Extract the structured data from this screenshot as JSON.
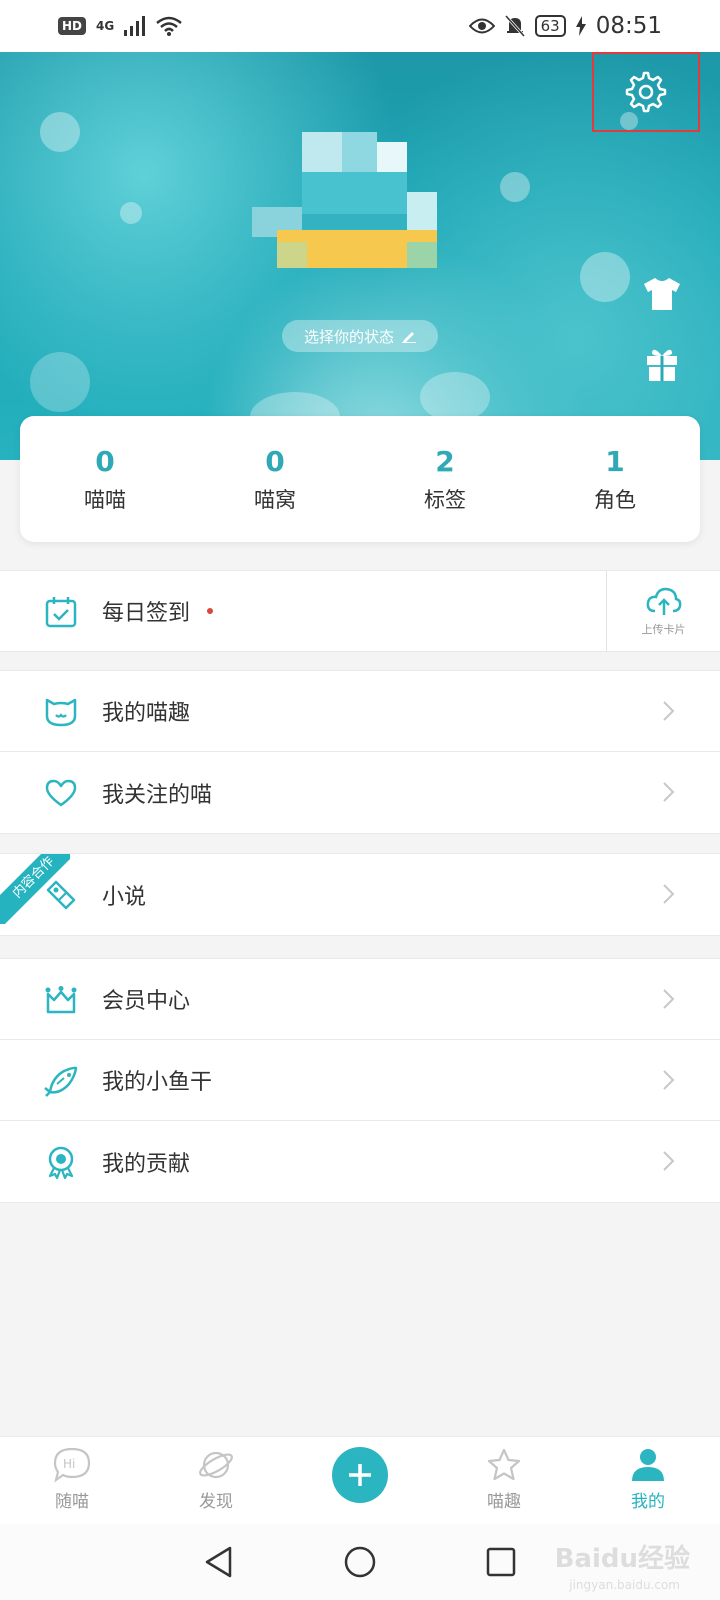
{
  "status_bar": {
    "network_badge": "HD",
    "network_type": "4G",
    "battery": "63",
    "time": "08:51"
  },
  "banner": {
    "status_prompt": "选择你的状态"
  },
  "stats": [
    {
      "value": "0",
      "label": "喵喵"
    },
    {
      "value": "0",
      "label": "喵窝"
    },
    {
      "value": "2",
      "label": "标签"
    },
    {
      "value": "1",
      "label": "角色"
    }
  ],
  "checkin": {
    "label": "每日签到",
    "upload_label": "上传卡片"
  },
  "menu_group1": [
    {
      "label": "我的喵趣",
      "icon": "cat-face-icon"
    },
    {
      "label": "我关注的喵",
      "icon": "heart-icon"
    }
  ],
  "novel": {
    "label": "小说",
    "ribbon": "内容合作"
  },
  "menu_group2": [
    {
      "label": "会员中心",
      "icon": "crown-icon"
    },
    {
      "label": "我的小鱼干",
      "icon": "fish-icon"
    },
    {
      "label": "我的贡献",
      "icon": "medal-icon"
    }
  ],
  "bottom_nav": [
    {
      "label": "随喵",
      "icon": "hi-bubble-icon"
    },
    {
      "label": "发现",
      "icon": "planet-icon"
    },
    {
      "label": "",
      "icon": "plus-icon"
    },
    {
      "label": "喵趣",
      "icon": "star-icon"
    },
    {
      "label": "我的",
      "icon": "person-icon"
    }
  ],
  "watermark": {
    "text": "Baidu经验",
    "url": "jingyan.baidu.com"
  },
  "colors": {
    "accent": "#2bb5c1",
    "highlight_border": "#e23b3b"
  }
}
